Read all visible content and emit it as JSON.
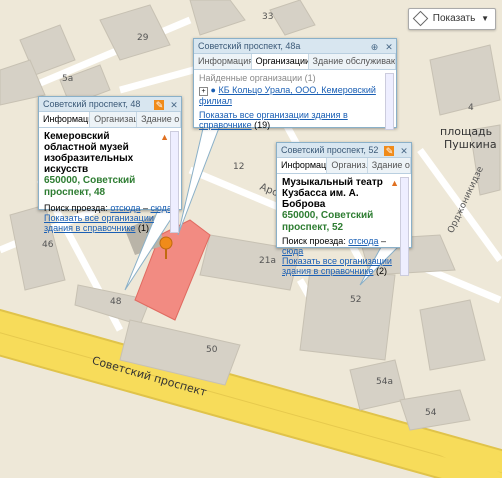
{
  "map": {
    "street_main": "Советский проспект",
    "street_aronnaya": "Ароничная",
    "street_ordzhonikidze": "Орджоникидзе",
    "square_label": "площадь Пушкина",
    "square_line1": "площадь",
    "square_line2": "Пушкина",
    "building_numbers": [
      "29",
      "33",
      "33",
      "5а",
      "4",
      "46",
      "48",
      "12",
      "50",
      "21а",
      "52",
      "54а",
      "54"
    ],
    "colors": {
      "road_yellow": "#f7dc5a",
      "building": "#d6d1c6",
      "building_top": "#e6e2d8",
      "highlight": "#f28b82",
      "ground": "#eee8d8",
      "park": "#d9ecd0"
    }
  },
  "show_button": {
    "label": "Показать",
    "icon": "layers-icon"
  },
  "popup1": {
    "title": "Советский проспект, 48",
    "tabs": [
      "Информация",
      "Организации",
      "Здание о..."
    ],
    "org_name": "Кемеровский областной музей изобразительных искусств",
    "address": "650000, Советский проспект, 48",
    "route_label": "Поиск проезда:",
    "route_from": "отсюда",
    "route_dash": "–",
    "route_to": "сюда",
    "all_orgs": "Показать все организации здания в справочнике",
    "all_orgs_count": "(1)"
  },
  "popup2": {
    "title": "Советский проспект, 48а",
    "tabs": [
      "Информация",
      "Организации",
      "Здание обслуживают"
    ],
    "found_label": "Найденные организации",
    "found_count": "(1)",
    "org": "КБ Кольцо Урала, ООО, Кемеровский филиал",
    "all_orgs": "Показать все организации здания в справочнике",
    "all_orgs_count": "(19)"
  },
  "popup3": {
    "title": "Советский проспект, 52",
    "tabs": [
      "Информация",
      "Организ...",
      "Здание о..."
    ],
    "org_name": "Музыкальный театр Кузбасса им. А. Боброва",
    "address": "650000, Советский проспект, 52",
    "route_label": "Поиск проезда:",
    "route_from": "отсюда",
    "route_dash": "–",
    "route_to": "сюда",
    "all_orgs": "Показать все организации здания в справочнике",
    "all_orgs_count": "(2)"
  }
}
